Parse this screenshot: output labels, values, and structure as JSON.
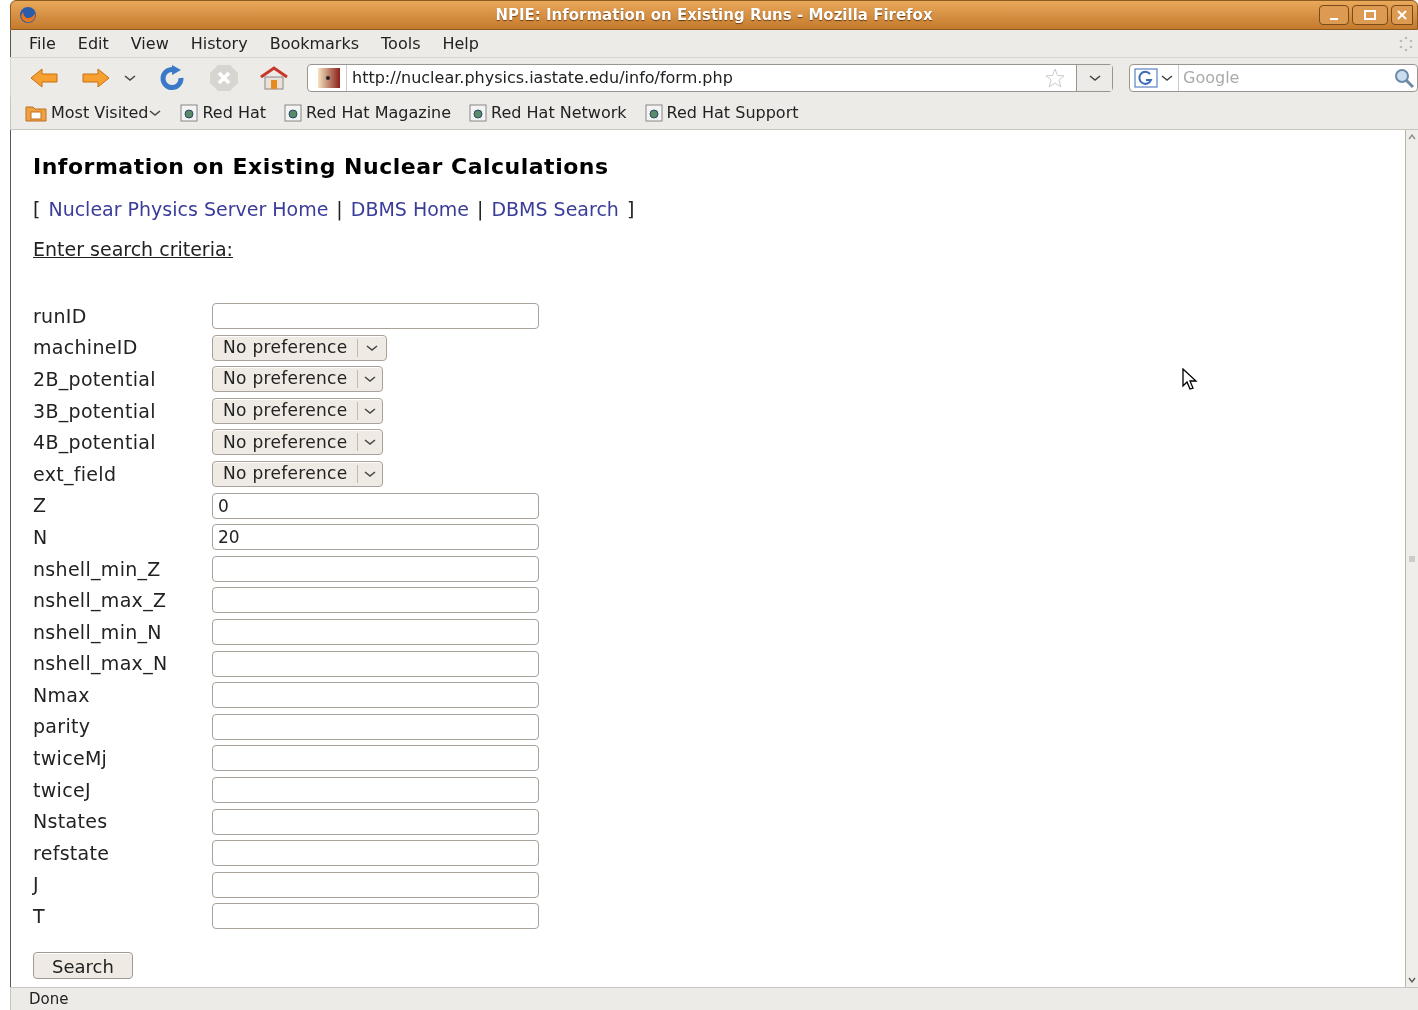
{
  "window": {
    "title": "NPIE: Information on Existing Runs - Mozilla Firefox"
  },
  "menu": [
    "File",
    "Edit",
    "View",
    "History",
    "Bookmarks",
    "Tools",
    "Help"
  ],
  "address_bar": {
    "value": "http://nuclear.physics.iastate.edu/info/form.php"
  },
  "search_bar": {
    "placeholder": "Google"
  },
  "bookmarks": [
    {
      "kind": "folder",
      "label": "Most Visited"
    },
    {
      "kind": "link",
      "label": "Red Hat"
    },
    {
      "kind": "link",
      "label": "Red Hat Magazine"
    },
    {
      "kind": "link",
      "label": "Red Hat Network"
    },
    {
      "kind": "link",
      "label": "Red Hat Support"
    }
  ],
  "page": {
    "heading": "Information on Existing Nuclear Calculations",
    "links": [
      "Nuclear Physics Server Home",
      "DBMS Home",
      "DBMS Search"
    ],
    "bracket_open": "[",
    "separator": "|",
    "bracket_close": "]",
    "subheading": "Enter search criteria:",
    "fields": [
      {
        "label": "runID",
        "kind": "text"
      },
      {
        "label": "machineID",
        "kind": "select",
        "value": "No preference"
      },
      {
        "label": "2B_potential",
        "kind": "select",
        "value": "No preference"
      },
      {
        "label": "3B_potential",
        "kind": "select",
        "value": "No preference"
      },
      {
        "label": "4B_potential",
        "kind": "select",
        "value": "No preference"
      },
      {
        "label": "ext_field",
        "kind": "select",
        "value": "No preference"
      },
      {
        "label": "Z",
        "kind": "text",
        "value": "0"
      },
      {
        "label": "N",
        "kind": "text",
        "value": "20"
      },
      {
        "label": "nshell_min_Z",
        "kind": "text"
      },
      {
        "label": "nshell_max_Z",
        "kind": "text"
      },
      {
        "label": "nshell_min_N",
        "kind": "text"
      },
      {
        "label": "nshell_max_N",
        "kind": "text"
      },
      {
        "label": "Nmax",
        "kind": "text"
      },
      {
        "label": "parity",
        "kind": "text"
      },
      {
        "label": "twiceMj",
        "kind": "text"
      },
      {
        "label": "twiceJ",
        "kind": "text"
      },
      {
        "label": "Nstates",
        "kind": "text"
      },
      {
        "label": "refstate",
        "kind": "text"
      },
      {
        "label": "J",
        "kind": "text"
      },
      {
        "label": "T",
        "kind": "text"
      }
    ],
    "submit": "Search"
  },
  "status_bar": {
    "text": "Done"
  }
}
